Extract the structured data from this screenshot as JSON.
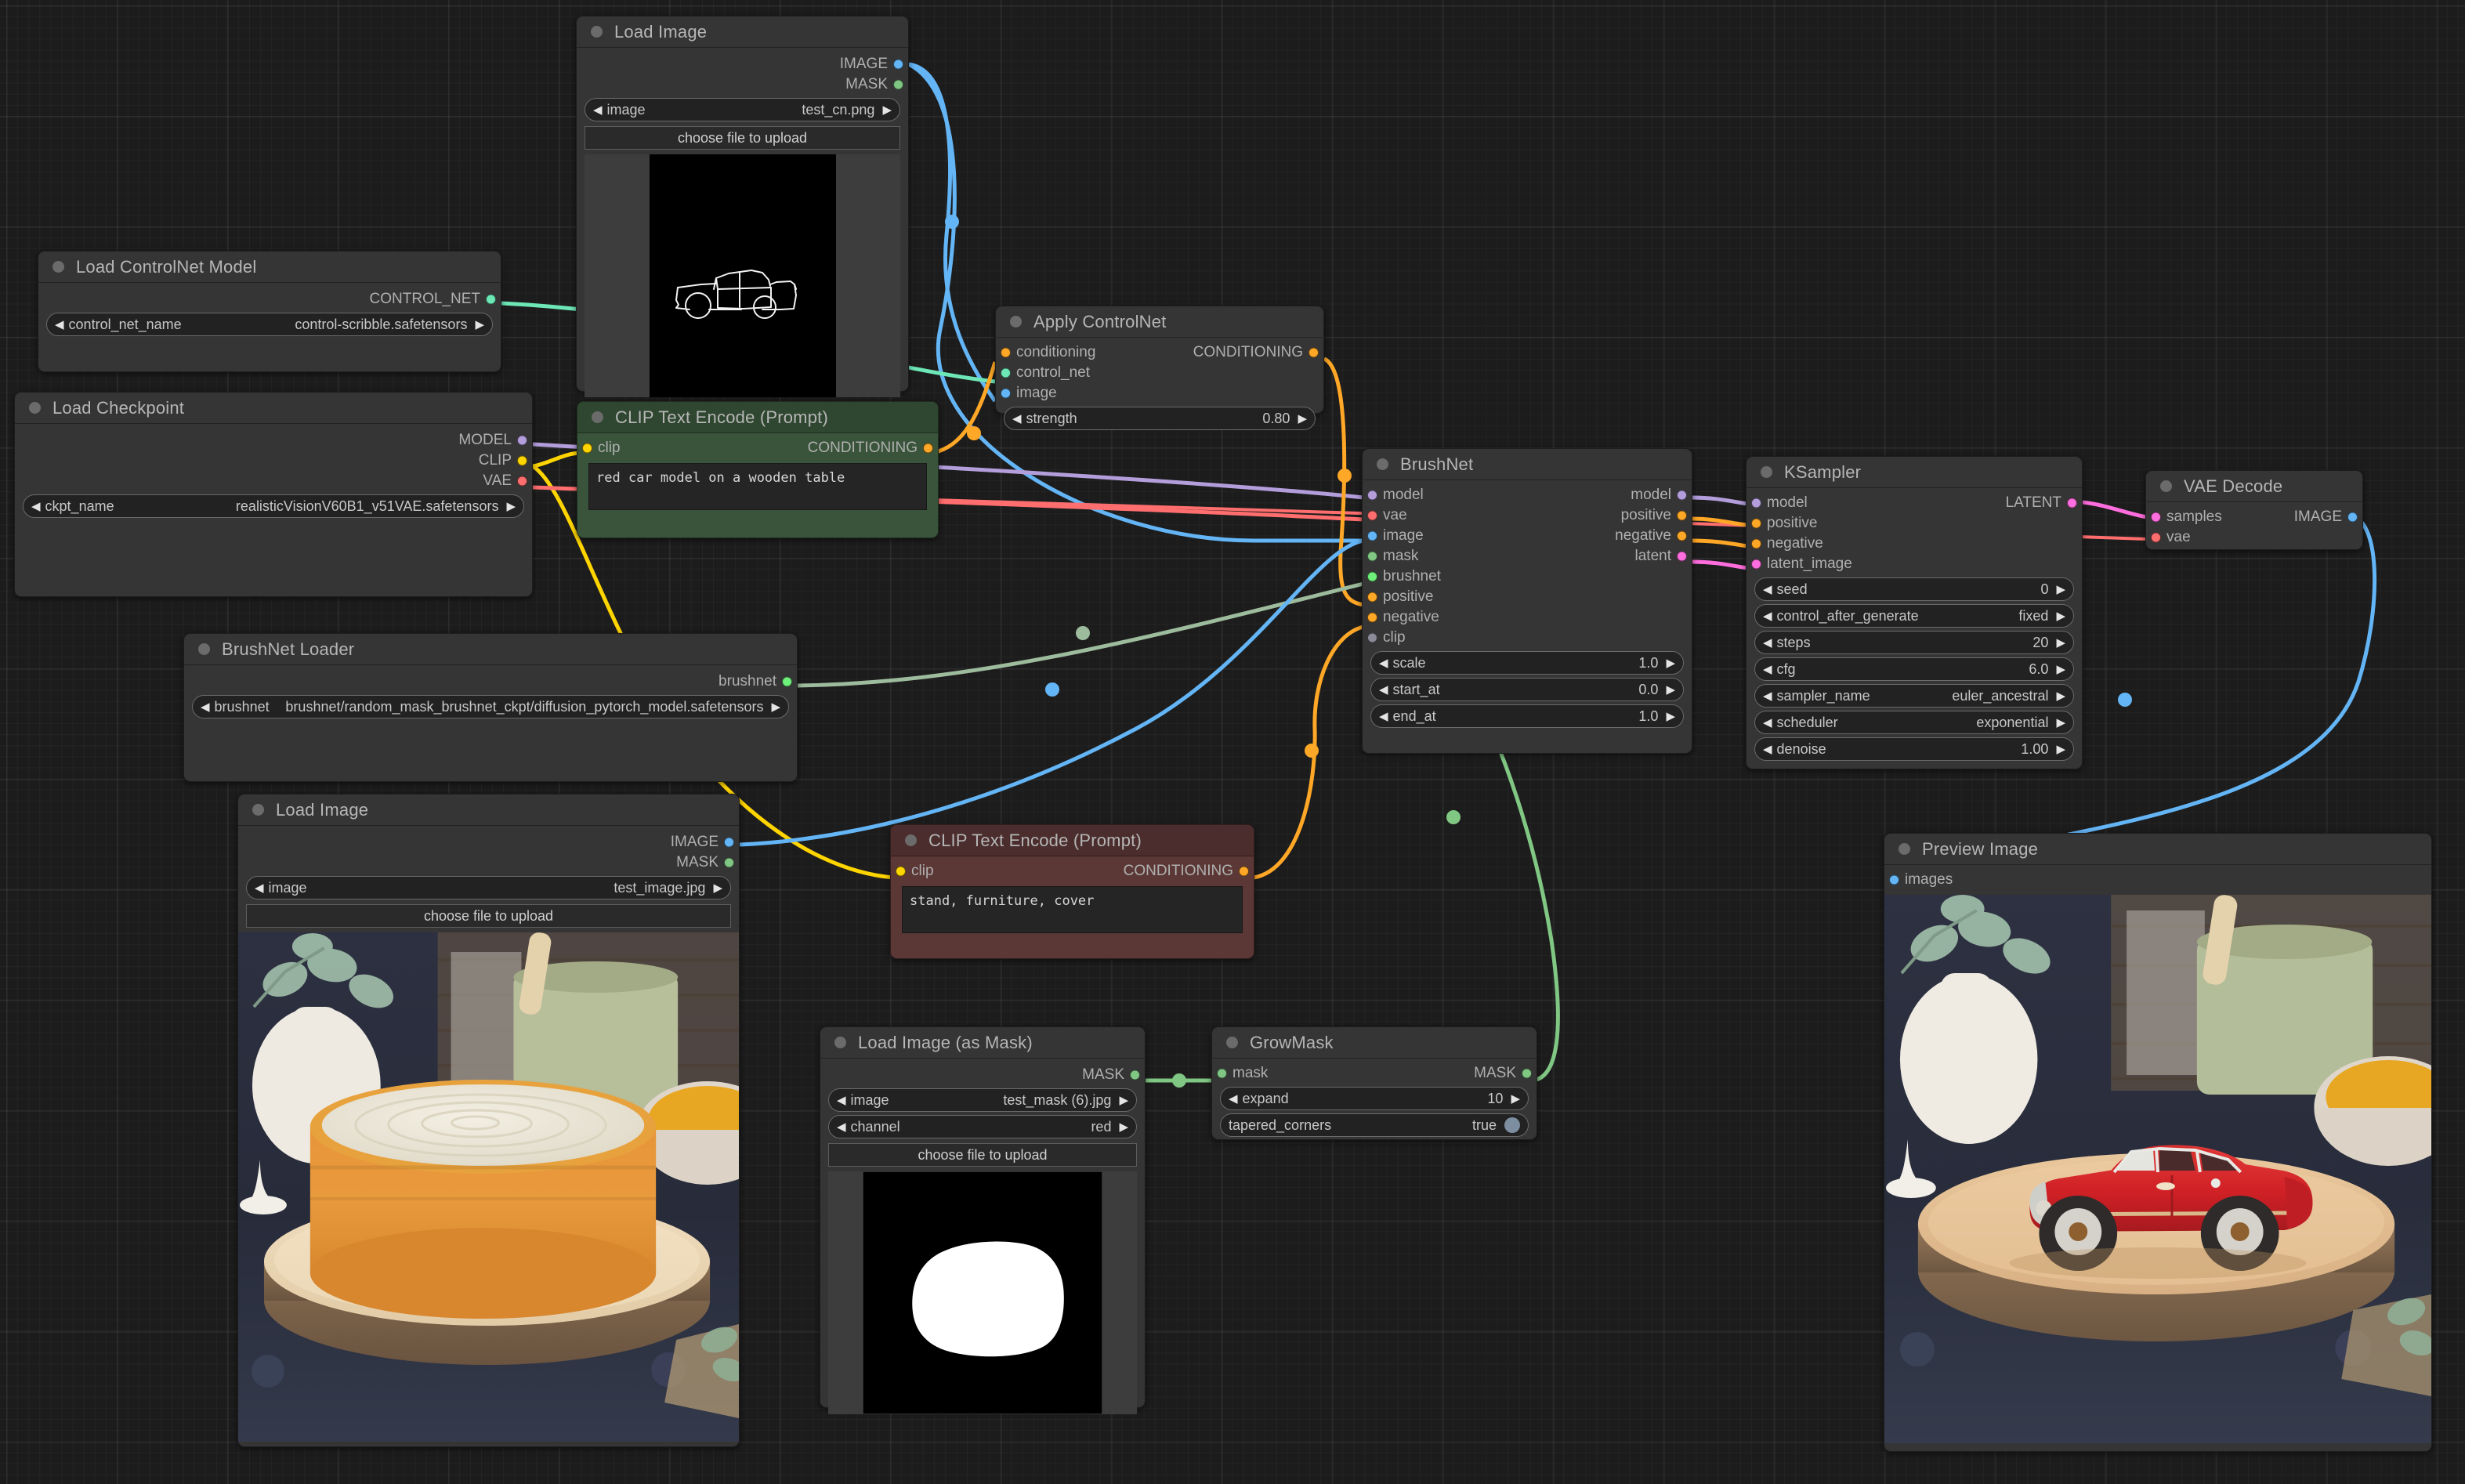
{
  "app": {
    "name": "ComfyUI",
    "canvas_background": "#1c1c1c"
  },
  "colors": {
    "IMAGE": "#64b5f6",
    "MASK": "#81c784",
    "CONTROL_NET": "#6ee7b7",
    "MODEL": "#b39ddb",
    "CLIP": "#ffd500",
    "VAE": "#ff6e6e",
    "CONDITIONING": "#ffa726",
    "LATENT": "#ff6ede",
    "BRUSHNET": "#6ef07a",
    "GENERIC": "#8a8a99"
  },
  "nodes": {
    "load_image_cn": {
      "title": "Load Image",
      "outputs": [
        {
          "label": "IMAGE",
          "type": "IMAGE"
        },
        {
          "label": "MASK",
          "type": "MASK"
        }
      ],
      "widgets": [
        {
          "name": "image",
          "value": "test_cn.png"
        }
      ],
      "upload_label": "choose file to upload",
      "preview": "scribble-car-black"
    },
    "load_controlnet": {
      "title": "Load ControlNet Model",
      "outputs": [
        {
          "label": "CONTROL_NET",
          "type": "CONTROL_NET"
        }
      ],
      "widgets": [
        {
          "name": "control_net_name",
          "value": "control-scribble.safetensors"
        }
      ]
    },
    "load_checkpoint": {
      "title": "Load Checkpoint",
      "outputs": [
        {
          "label": "MODEL",
          "type": "MODEL"
        },
        {
          "label": "CLIP",
          "type": "CLIP"
        },
        {
          "label": "VAE",
          "type": "VAE"
        }
      ],
      "widgets": [
        {
          "name": "ckpt_name",
          "value": "realisticVisionV60B1_v51VAE.safetensors"
        }
      ]
    },
    "clip_positive": {
      "title": "CLIP Text Encode (Prompt)",
      "color": "green",
      "inputs": [
        {
          "label": "clip",
          "type": "CLIP"
        }
      ],
      "outputs": [
        {
          "label": "CONDITIONING",
          "type": "CONDITIONING"
        }
      ],
      "text": "red car model on a wooden table"
    },
    "clip_negative": {
      "title": "CLIP Text Encode (Prompt)",
      "color": "red",
      "inputs": [
        {
          "label": "clip",
          "type": "CLIP"
        }
      ],
      "outputs": [
        {
          "label": "CONDITIONING",
          "type": "CONDITIONING"
        }
      ],
      "text": "stand, furniture, cover"
    },
    "apply_controlnet": {
      "title": "Apply ControlNet",
      "inputs": [
        {
          "label": "conditioning",
          "type": "CONDITIONING"
        },
        {
          "label": "control_net",
          "type": "CONTROL_NET"
        },
        {
          "label": "image",
          "type": "IMAGE"
        }
      ],
      "outputs": [
        {
          "label": "CONDITIONING",
          "type": "CONDITIONING"
        }
      ],
      "widgets": [
        {
          "name": "strength",
          "value": "0.80"
        }
      ]
    },
    "brushnet_loader": {
      "title": "BrushNet Loader",
      "outputs": [
        {
          "label": "brushnet",
          "type": "BRUSHNET"
        }
      ],
      "widgets": [
        {
          "name": "brushnet",
          "value": "brushnet/random_mask_brushnet_ckpt/diffusion_pytorch_model.safetensors"
        }
      ]
    },
    "brushnet": {
      "title": "BrushNet",
      "inputs": [
        {
          "label": "model",
          "type": "MODEL"
        },
        {
          "label": "vae",
          "type": "VAE"
        },
        {
          "label": "image",
          "type": "IMAGE"
        },
        {
          "label": "mask",
          "type": "MASK"
        },
        {
          "label": "brushnet",
          "type": "BRUSHNET"
        },
        {
          "label": "positive",
          "type": "CONDITIONING"
        },
        {
          "label": "negative",
          "type": "CONDITIONING"
        },
        {
          "label": "clip",
          "type": "GENERIC"
        }
      ],
      "outputs": [
        {
          "label": "model",
          "type": "MODEL"
        },
        {
          "label": "positive",
          "type": "CONDITIONING"
        },
        {
          "label": "negative",
          "type": "CONDITIONING"
        },
        {
          "label": "latent",
          "type": "LATENT"
        }
      ],
      "widgets": [
        {
          "name": "scale",
          "value": "1.0"
        },
        {
          "name": "start_at",
          "value": "0.0"
        },
        {
          "name": "end_at",
          "value": "1.0"
        }
      ]
    },
    "ksampler": {
      "title": "KSampler",
      "inputs": [
        {
          "label": "model",
          "type": "MODEL"
        },
        {
          "label": "positive",
          "type": "CONDITIONING"
        },
        {
          "label": "negative",
          "type": "CONDITIONING"
        },
        {
          "label": "latent_image",
          "type": "LATENT"
        }
      ],
      "outputs": [
        {
          "label": "LATENT",
          "type": "LATENT"
        }
      ],
      "widgets": [
        {
          "name": "seed",
          "value": "0"
        },
        {
          "name": "control_after_generate",
          "value": "fixed"
        },
        {
          "name": "steps",
          "value": "20"
        },
        {
          "name": "cfg",
          "value": "6.0"
        },
        {
          "name": "sampler_name",
          "value": "euler_ancestral"
        },
        {
          "name": "scheduler",
          "value": "exponential"
        },
        {
          "name": "denoise",
          "value": "1.00"
        }
      ]
    },
    "vae_decode": {
      "title": "VAE Decode",
      "inputs": [
        {
          "label": "samples",
          "type": "LATENT"
        },
        {
          "label": "vae",
          "type": "VAE"
        }
      ],
      "outputs": [
        {
          "label": "IMAGE",
          "type": "IMAGE"
        }
      ]
    },
    "load_image_src": {
      "title": "Load Image",
      "outputs": [
        {
          "label": "IMAGE",
          "type": "IMAGE"
        },
        {
          "label": "MASK",
          "type": "MASK"
        }
      ],
      "widgets": [
        {
          "name": "image",
          "value": "test_image.jpg"
        }
      ],
      "upload_label": "choose file to upload",
      "preview": "cake-photo"
    },
    "load_image_mask": {
      "title": "Load Image (as Mask)",
      "outputs": [
        {
          "label": "MASK",
          "type": "MASK"
        }
      ],
      "widgets": [
        {
          "name": "image",
          "value": "test_mask (6).jpg"
        },
        {
          "name": "channel",
          "value": "red"
        }
      ],
      "upload_label": "choose file to upload",
      "preview": "mask-blob-black"
    },
    "grow_mask": {
      "title": "GrowMask",
      "inputs": [
        {
          "label": "mask",
          "type": "MASK"
        }
      ],
      "outputs": [
        {
          "label": "MASK",
          "type": "MASK"
        }
      ],
      "widgets": [
        {
          "name": "expand",
          "value": "10"
        },
        {
          "name": "tapered_corners",
          "value": "true",
          "kind": "toggle"
        }
      ]
    },
    "preview_image": {
      "title": "Preview Image",
      "inputs": [
        {
          "label": "images",
          "type": "IMAGE"
        }
      ],
      "preview": "red-car-photo"
    }
  }
}
